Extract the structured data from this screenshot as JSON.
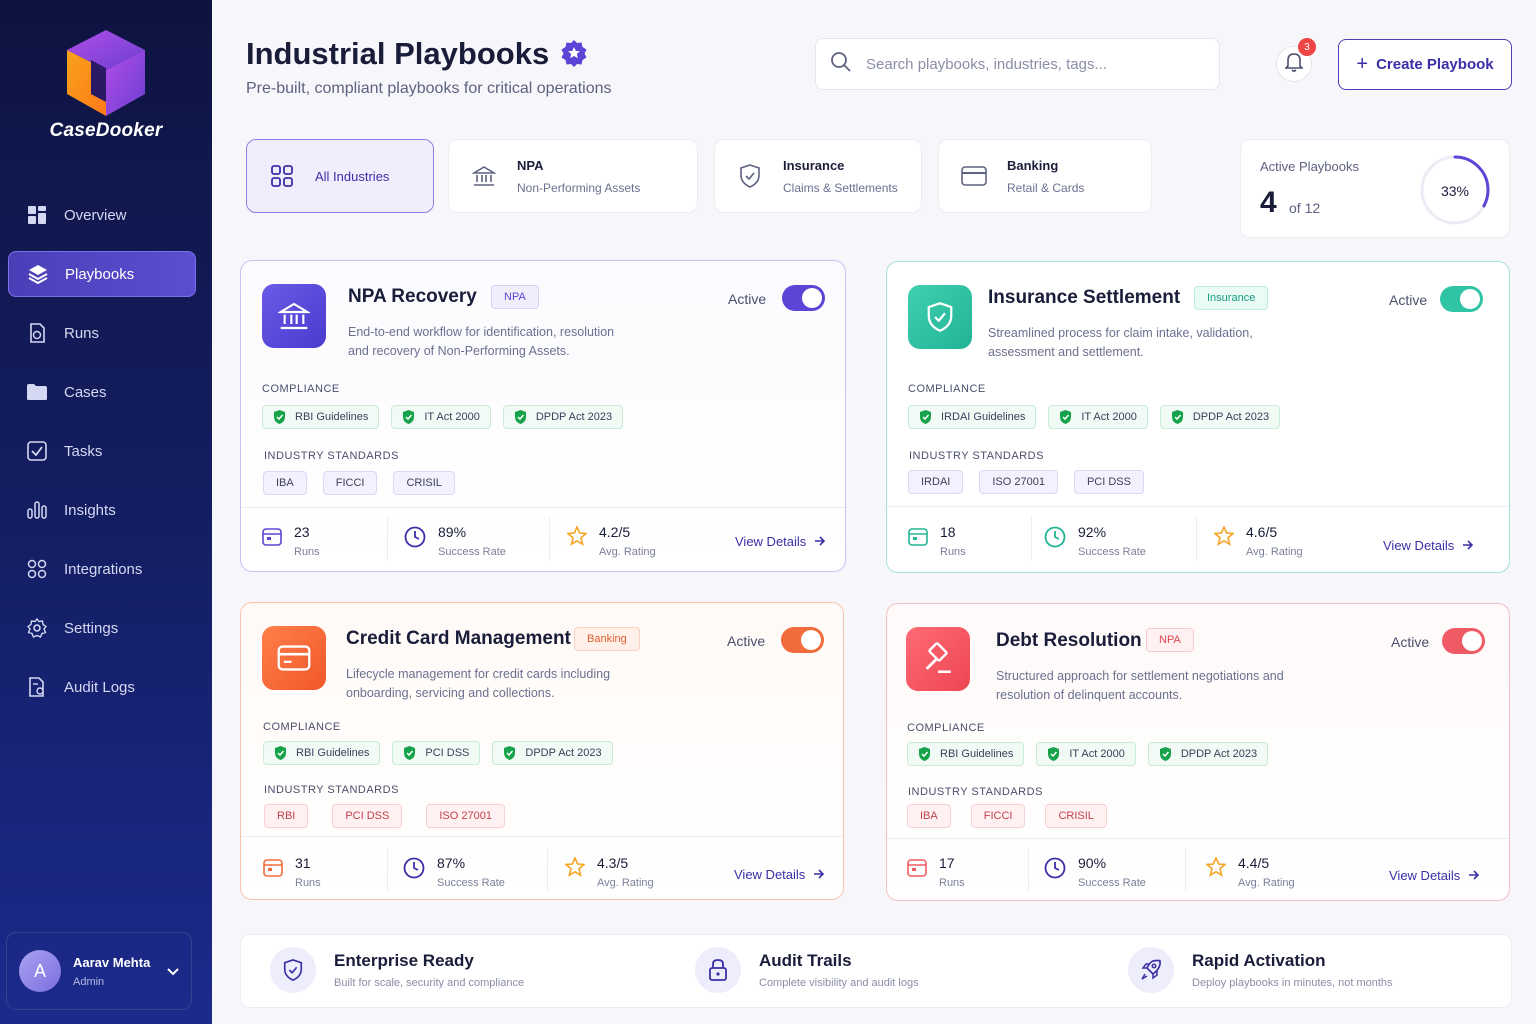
{
  "app": {
    "name": "CaseDooker"
  },
  "sidebar": {
    "items": [
      {
        "label": "Overview",
        "icon": "grid-icon"
      },
      {
        "label": "Playbooks",
        "icon": "layers-icon",
        "active": true
      },
      {
        "label": "Runs",
        "icon": "run-file-icon"
      },
      {
        "label": "Cases",
        "icon": "folder-icon"
      },
      {
        "label": "Tasks",
        "icon": "checkbox-icon"
      },
      {
        "label": "Insights",
        "icon": "bar-chart-icon"
      },
      {
        "label": "Integrations",
        "icon": "integrations-icon"
      },
      {
        "label": "Settings",
        "icon": "gear-icon"
      },
      {
        "label": "Audit Logs",
        "icon": "audit-file-icon"
      }
    ],
    "user": {
      "initial": "A",
      "name": "Aarav Mehta",
      "role": "Admin"
    }
  },
  "header": {
    "title": "Industrial Playbooks",
    "subtitle": "Pre-built, compliant playbooks for critical operations",
    "search_placeholder": "Search playbooks, industries, tags...",
    "notification_count": "3",
    "create_label": "Create Playbook"
  },
  "filters": [
    {
      "title": "All Industries",
      "sub": ""
    },
    {
      "title": "NPA",
      "sub": "Non-Performing Assets"
    },
    {
      "title": "Insurance",
      "sub": "Claims & Settlements"
    },
    {
      "title": "Banking",
      "sub": "Retail & Cards"
    }
  ],
  "active_stat": {
    "label": "Active Playbooks",
    "count": "4",
    "total": "of 12",
    "percent_label": "33%",
    "percent": 33
  },
  "cards": [
    {
      "title": "NPA Recovery",
      "tag": "NPA",
      "theme": "purple",
      "description": "End-to-end workflow for identification, resolution and recovery of Non-Performing Assets.",
      "active_label": "Active",
      "enabled": true,
      "compliance_label": "COMPLIANCE",
      "compliance": [
        "RBI Guidelines",
        "IT Act 2000",
        "DPDP Act 2023"
      ],
      "standards_label": "INDUSTRY STANDARDS",
      "standards": [
        "IBA",
        "FICCI",
        "CRISIL"
      ],
      "runs": "23",
      "runs_label": "Runs",
      "success": "89%",
      "success_label": "Success Rate",
      "rating": "4.2/5",
      "rating_label": "Avg. Rating",
      "link": "View Details"
    },
    {
      "title": "Insurance Settlement",
      "tag": "Insurance",
      "theme": "teal",
      "description": "Streamlined process for claim intake, validation, assessment and settlement.",
      "active_label": "Active",
      "enabled": true,
      "compliance_label": "COMPLIANCE",
      "compliance": [
        "IRDAI Guidelines",
        "IT Act 2000",
        "DPDP Act 2023"
      ],
      "standards_label": "INDUSTRY STANDARDS",
      "standards": [
        "IRDAI",
        "ISO 27001",
        "PCI DSS"
      ],
      "runs": "18",
      "runs_label": "Runs",
      "success": "92%",
      "success_label": "Success Rate",
      "rating": "4.6/5",
      "rating_label": "Avg. Rating",
      "link": "View Details"
    },
    {
      "title": "Credit Card Management",
      "tag": "Banking",
      "theme": "orange",
      "description": "Lifecycle management for credit cards including onboarding, servicing and collections.",
      "active_label": "Active",
      "enabled": true,
      "compliance_label": "COMPLIANCE",
      "compliance": [
        "RBI Guidelines",
        "PCI DSS",
        "DPDP Act 2023"
      ],
      "standards_label": "INDUSTRY STANDARDS",
      "standards": [
        "RBI",
        "PCI DSS",
        "ISO 27001"
      ],
      "runs": "31",
      "runs_label": "Runs",
      "success": "87%",
      "success_label": "Success Rate",
      "rating": "4.3/5",
      "rating_label": "Avg. Rating",
      "link": "View Details"
    },
    {
      "title": "Debt Resolution",
      "tag": "NPA",
      "theme": "red",
      "description": "Structured approach for settlement negotiations and resolution of delinquent accounts.",
      "active_label": "Active",
      "enabled": true,
      "compliance_label": "COMPLIANCE",
      "compliance": [
        "RBI Guidelines",
        "IT Act 2000",
        "DPDP Act 2023"
      ],
      "standards_label": "INDUSTRY STANDARDS",
      "standards": [
        "IBA",
        "FICCI",
        "CRISIL"
      ],
      "runs": "17",
      "runs_label": "Runs",
      "success": "90%",
      "success_label": "Success Rate",
      "rating": "4.4/5",
      "rating_label": "Avg. Rating",
      "link": "View Details"
    }
  ],
  "features": [
    {
      "title": "Enterprise Ready",
      "sub": "Built for scale, security and compliance",
      "icon": "shield-check-icon"
    },
    {
      "title": "Audit Trails",
      "sub": "Complete visibility and audit logs",
      "icon": "lock-icon"
    },
    {
      "title": "Rapid Activation",
      "sub": "Deploy playbooks in minutes, not months",
      "icon": "rocket-icon"
    }
  ],
  "colors": {
    "primary": "#4b3fb8",
    "teal": "#2fc4a4",
    "orange": "#f26b3a",
    "red": "#ef5a65"
  }
}
